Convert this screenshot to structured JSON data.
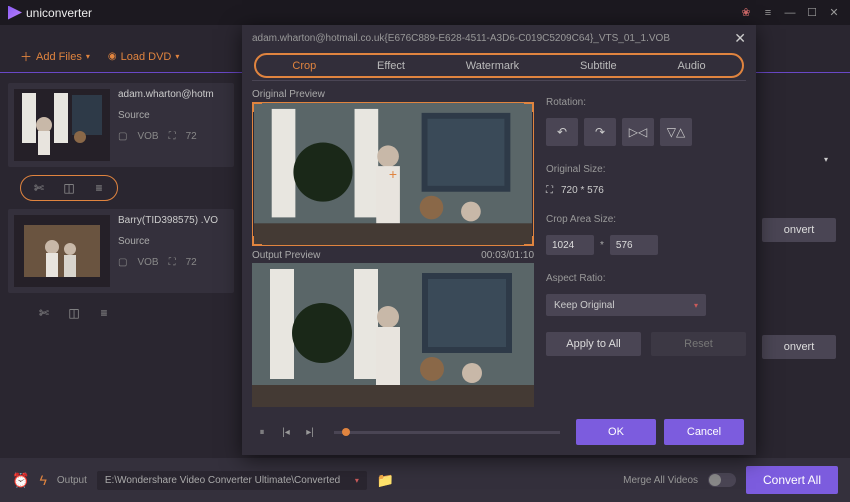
{
  "brand": "uniconverter",
  "toolbar": {
    "add_files": "Add Files",
    "load_dvd": "Load DVD"
  },
  "files": [
    {
      "name": "adam.wharton@hotm",
      "source_label": "Source",
      "format": "VOB",
      "res": "72"
    },
    {
      "name": "Barry(TID398575) .VO",
      "source_label": "Source",
      "format": "VOB",
      "res": "72"
    }
  ],
  "convert_label": "onvert",
  "editor": {
    "filename": "adam.wharton@hotmail.co.uk{E676C889-E628-4511-A3D6-C019C5209C64}_VTS_01_1.VOB",
    "tabs": {
      "crop": "Crop",
      "effect": "Effect",
      "watermark": "Watermark",
      "subtitle": "Subtitle",
      "audio": "Audio"
    },
    "orig_preview": "Original Preview",
    "output_preview": "Output Preview",
    "time": "00:03/01:10",
    "rotation_label": "Rotation:",
    "orig_size_label": "Original Size:",
    "orig_size_value": "720 * 576",
    "crop_size_label": "Crop Area Size:",
    "crop_w": "1024",
    "crop_h": "576",
    "aspect_label": "Aspect Ratio:",
    "aspect_value": "Keep Original",
    "apply_all": "Apply to All",
    "reset": "Reset",
    "ok": "OK",
    "cancel": "Cancel"
  },
  "bottom": {
    "output_label": "Output",
    "output_path": "E:\\Wondershare Video Converter Ultimate\\Converted",
    "merge_label": "Merge All Videos",
    "convert_all": "Convert All"
  }
}
